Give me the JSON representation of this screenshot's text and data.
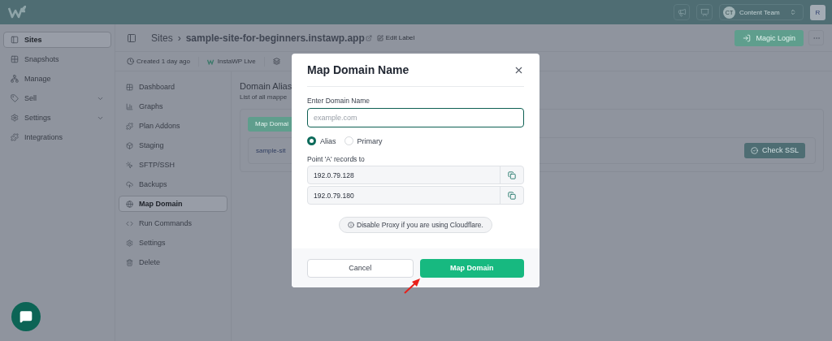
{
  "topbar": {
    "team": {
      "initials": "CT",
      "name": "Content Team"
    },
    "user_initial": "R"
  },
  "sidebar": {
    "items": [
      {
        "label": "Sites",
        "selected": true,
        "expandable": false
      },
      {
        "label": "Snapshots",
        "selected": false,
        "expandable": false
      },
      {
        "label": "Manage",
        "selected": false,
        "expandable": false
      },
      {
        "label": "Sell",
        "selected": false,
        "expandable": true
      },
      {
        "label": "Settings",
        "selected": false,
        "expandable": true
      },
      {
        "label": "Integrations",
        "selected": false,
        "expandable": false
      }
    ]
  },
  "header": {
    "breadcrumb": "Sites",
    "separator": "›",
    "site": "sample-site-for-beginners.instawp.app",
    "edit_label": "Edit Label",
    "magic_login": "Magic Login"
  },
  "meta": {
    "created": "Created 1 day ago",
    "platform": "InstaWP Live"
  },
  "site_nav": {
    "items": [
      {
        "label": "Dashboard",
        "selected": false
      },
      {
        "label": "Graphs",
        "selected": false
      },
      {
        "label": "Plan Addons",
        "selected": false
      },
      {
        "label": "Staging",
        "selected": false
      },
      {
        "label": "SFTP/SSH",
        "selected": false
      },
      {
        "label": "Backups",
        "selected": false
      },
      {
        "label": "Map Domain",
        "selected": true
      },
      {
        "label": "Run Commands",
        "selected": false
      },
      {
        "label": "Settings",
        "selected": false
      },
      {
        "label": "Delete",
        "selected": false
      }
    ]
  },
  "content": {
    "title": "Domain Alias",
    "subtitle": "List of all mappe",
    "map_button": "Map Domai",
    "domain": "sample-sit",
    "check_ssl": "Check SSL"
  },
  "modal": {
    "title": "Map Domain Name",
    "field_label": "Enter Domain Name",
    "placeholder": "example.com",
    "options": [
      {
        "label": "Alias",
        "selected": true
      },
      {
        "label": "Primary",
        "selected": false
      }
    ],
    "records_label": "Point 'A' records to",
    "records": [
      "192.0.79.128",
      "192.0.79.180"
    ],
    "note": "Disable Proxy if you are using Cloudflare.",
    "cancel": "Cancel",
    "submit": "Map Domain"
  }
}
